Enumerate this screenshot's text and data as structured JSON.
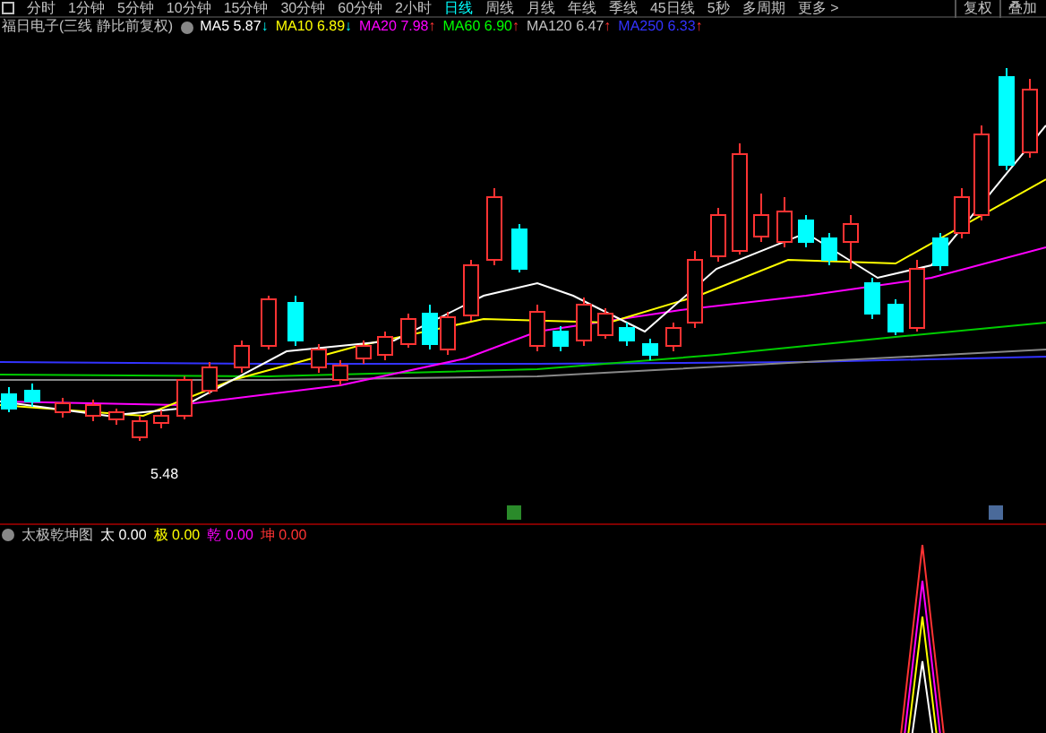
{
  "periods": [
    {
      "label": "分时",
      "selected": false
    },
    {
      "label": "1分钟",
      "selected": false
    },
    {
      "label": "5分钟",
      "selected": false
    },
    {
      "label": "10分钟",
      "selected": false
    },
    {
      "label": "15分钟",
      "selected": false
    },
    {
      "label": "30分钟",
      "selected": false
    },
    {
      "label": "60分钟",
      "selected": false
    },
    {
      "label": "2小时",
      "selected": false
    },
    {
      "label": "日线",
      "selected": true
    },
    {
      "label": "周线",
      "selected": false
    },
    {
      "label": "月线",
      "selected": false
    },
    {
      "label": "年线",
      "selected": false
    },
    {
      "label": "季线",
      "selected": false
    },
    {
      "label": "45日线",
      "selected": false
    },
    {
      "label": "5秒",
      "selected": false
    },
    {
      "label": "多周期",
      "selected": false
    },
    {
      "label": "更多 >",
      "selected": false
    }
  ],
  "toolbar_buttons": [
    "复权",
    "叠加"
  ],
  "main_chart": {
    "title": "福日电子(三线 静比前复权)",
    "indicators": [
      {
        "name": "MA5",
        "value": "5.87",
        "arrow": "↓",
        "rising": false,
        "color": "#ffffff"
      },
      {
        "name": "MA10",
        "value": "6.89",
        "arrow": "↓",
        "rising": false,
        "color": "#ffff00"
      },
      {
        "name": "MA20",
        "value": "7.98",
        "arrow": "↑",
        "rising": true,
        "color": "#ff00ff"
      },
      {
        "name": "MA60",
        "value": "6.90",
        "arrow": "↑",
        "rising": true,
        "color": "#00ff00"
      },
      {
        "name": "MA120",
        "value": "6.47",
        "arrow": "↑",
        "rising": true,
        "color": "#c0c0c0"
      },
      {
        "name": "MA250",
        "value": "6.33",
        "arrow": "↑",
        "rising": true,
        "color": "#3333ff"
      }
    ],
    "low_label": "5.48"
  },
  "sub_chart": {
    "title": "太极乾坤图",
    "values": [
      {
        "name": "太",
        "value": "0.00",
        "color": "#ffffff"
      },
      {
        "name": "极",
        "value": "0.00",
        "color": "#ffff00"
      },
      {
        "name": "乾",
        "value": "0.00",
        "color": "#ff00ff"
      },
      {
        "name": "坤",
        "value": "0.00",
        "color": "#ff3333"
      }
    ]
  }
}
